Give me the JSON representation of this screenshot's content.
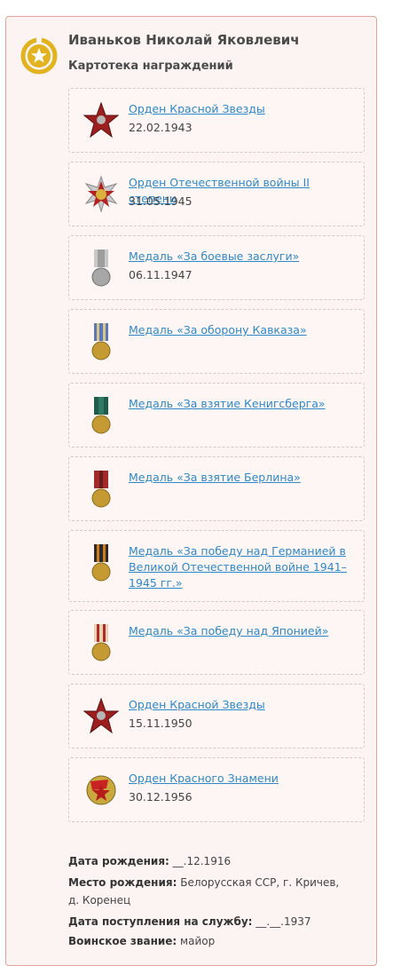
{
  "person": {
    "name": "Иваньков Николай Яковлевич",
    "section_title": "Картотека награждений"
  },
  "awards": [
    {
      "title": "Орден Красной Звезды",
      "date": "22.02.1943",
      "icon": "red-star-order-icon"
    },
    {
      "title": "Орден Отечественной войны II степени",
      "date": "31.05.1945",
      "icon": "patriotic-war-order-icon"
    },
    {
      "title": "Медаль «За боевые заслуги»",
      "date": "06.11.1947",
      "icon": "combat-merit-medal-icon"
    },
    {
      "title": "Медаль «За оборону Кавказа»",
      "date": "",
      "icon": "caucasus-medal-icon"
    },
    {
      "title": "Медаль «За взятие Кенигсберга»",
      "date": "",
      "icon": "koenigsberg-medal-icon"
    },
    {
      "title": "Медаль «За взятие Берлина»",
      "date": "",
      "icon": "berlin-medal-icon"
    },
    {
      "title": "Медаль «За победу над Германией в Великой Отечественной войне 1941–1945 гг.»",
      "date": "",
      "icon": "victory-germany-medal-icon"
    },
    {
      "title": "Медаль «За победу над Японией»",
      "date": "",
      "icon": "victory-japan-medal-icon"
    },
    {
      "title": "Орден Красной Звезды",
      "date": "15.11.1950",
      "icon": "red-star-order-icon"
    },
    {
      "title": "Орден Красного Знамени",
      "date": "30.12.1956",
      "icon": "red-banner-order-icon"
    }
  ],
  "info": {
    "birth_date_label": "Дата рождения:",
    "birth_date_value": "__.12.1916",
    "birth_place_label": "Место рождения:",
    "birth_place_value": "Белорусская ССР, г. Кричев, д. Коренец",
    "service_date_label": "Дата поступления на службу:",
    "service_date_value": "__.__.1937",
    "rank_label": "Воинское звание:",
    "rank_value": "майор"
  },
  "colors": {
    "link": "#2f88c8",
    "card_border": "#e2a39a",
    "card_bg": "#fcf4f2",
    "badge": "#e0b020"
  }
}
